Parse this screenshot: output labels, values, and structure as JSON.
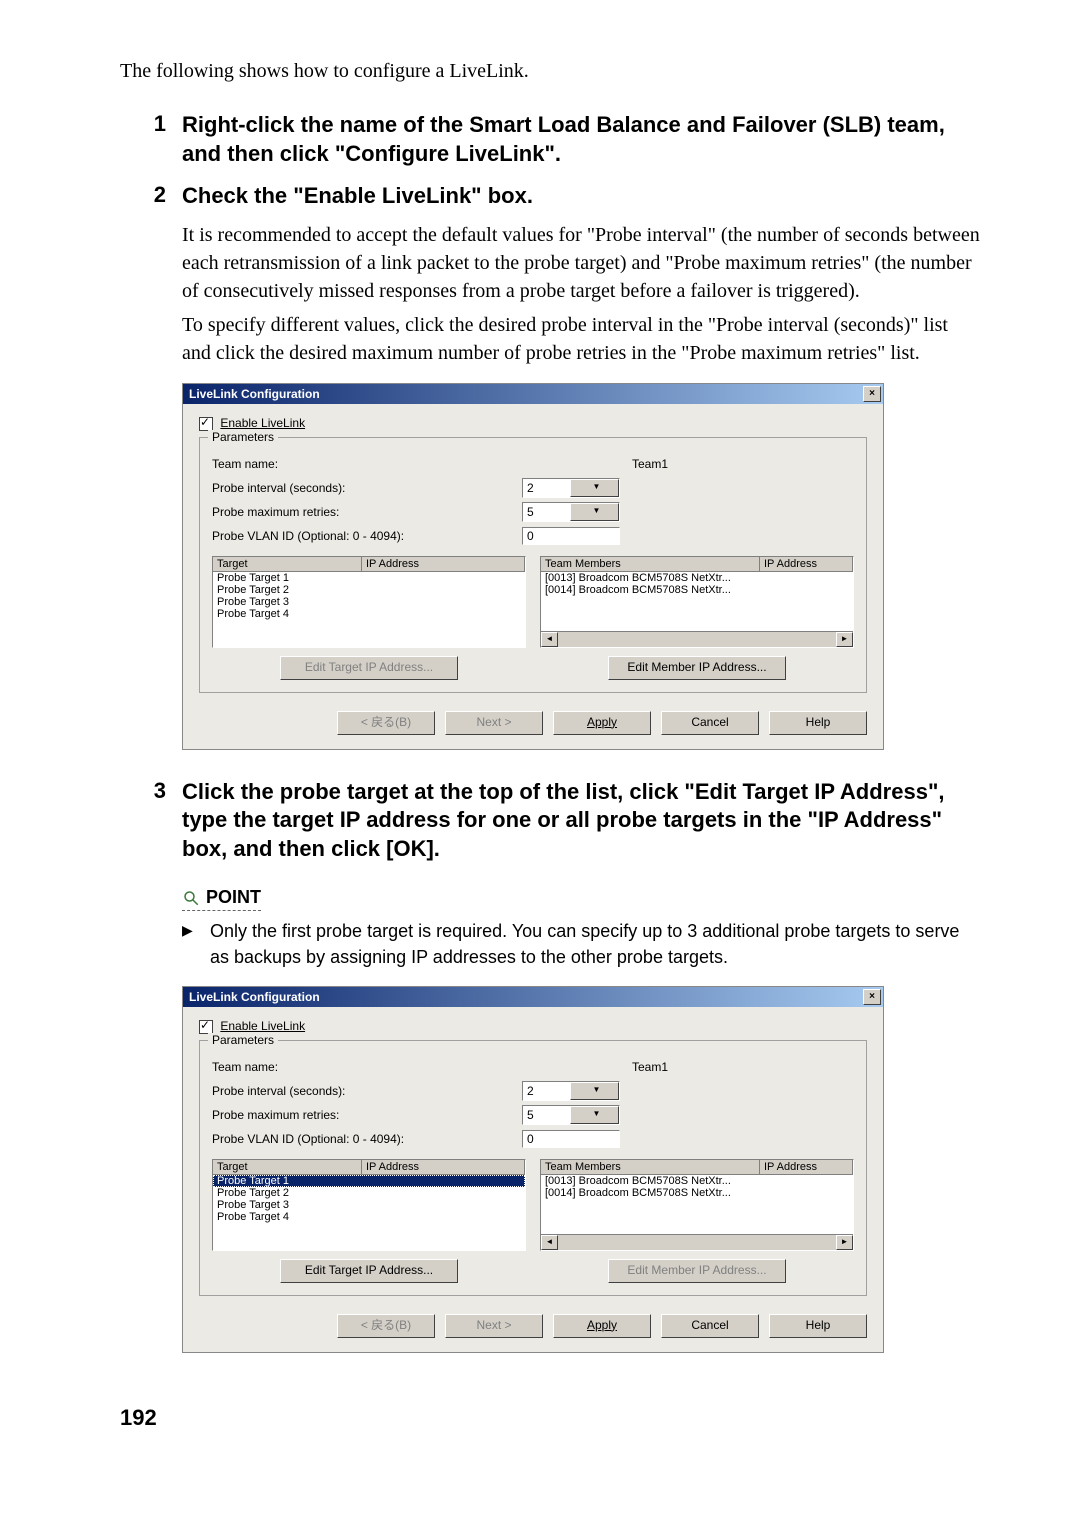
{
  "intro": "The following shows how to configure a LiveLink.",
  "steps": {
    "s1": {
      "num": "1",
      "title": "Right-click the name of the Smart Load Balance and Failover (SLB) team, and then click \"Configure LiveLink\"."
    },
    "s2": {
      "num": "2",
      "title": "Check the \"Enable LiveLink\" box.",
      "body1": "It is recommended to accept the default values for \"Probe interval\" (the number of seconds between each retransmission of a link packet to the probe target) and \"Probe maximum retries\" (the number of consecutively missed responses from a probe target before a failover is triggered).",
      "body2": "To specify different values, click the desired probe interval in the \"Probe interval (seconds)\" list and click the desired maximum number of probe retries in the \"Probe maximum retries\" list."
    },
    "s3": {
      "num": "3",
      "title": "Click the probe target at the top of the list, click \"Edit Target IP Address\", type the target IP address for one or all probe targets in the \"IP Address\" box, and then click [OK]."
    }
  },
  "point": {
    "label": "POINT",
    "text": "Only the first probe target is required. You can specify up to 3 additional probe targets to serve as backups by assigning IP addresses to the other probe targets."
  },
  "dialog": {
    "title": "LiveLink Configuration",
    "enable_label": "Enable LiveLink",
    "params_label": "Parameters",
    "team_name_label": "Team name:",
    "team_name_value": "Team1",
    "probe_interval_label": "Probe interval (seconds):",
    "probe_interval_value": "2",
    "probe_retries_label": "Probe maximum retries:",
    "probe_retries_value": "5",
    "probe_vlan_label": "Probe VLAN ID (Optional: 0 - 4094):",
    "probe_vlan_value": "0",
    "target_hdr": "Target",
    "ip_hdr": "IP Address",
    "members_hdr": "Team Members",
    "targets": [
      "Probe Target 1",
      "Probe Target 2",
      "Probe Target 3",
      "Probe Target 4"
    ],
    "members": [
      "[0013] Broadcom BCM5708S NetXtr...",
      "[0014] Broadcom BCM5708S NetXtr..."
    ],
    "edit_target_btn": "Edit Target IP Address...",
    "edit_member_btn": "Edit Member IP Address...",
    "back_btn": "< 戻る(B)",
    "next_btn": "Next >",
    "apply_btn": "Apply",
    "cancel_btn": "Cancel",
    "help_btn": "Help"
  },
  "page_number": "192"
}
